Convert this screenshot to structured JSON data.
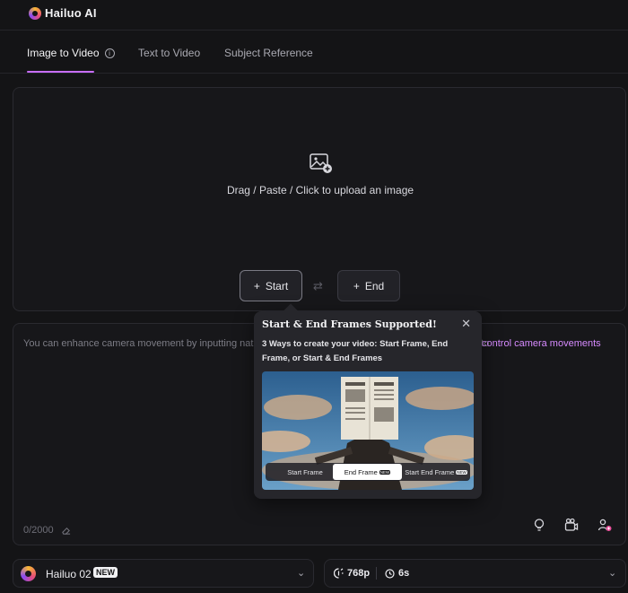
{
  "app": {
    "logo_text": "Hailuo AI"
  },
  "tabs": [
    {
      "label": "Image to Video",
      "active": true
    },
    {
      "label": "Text to Video",
      "active": false
    },
    {
      "label": "Subject Reference",
      "active": false
    }
  ],
  "upload": {
    "text": "Drag / Paste / Click to upload an image",
    "start_label": "Start",
    "end_label": "End"
  },
  "prompt": {
    "placeholder_visible": "You can enhance camera movement by inputting natu",
    "placeholder_tail": "how to",
    "link_text": "control camera movements",
    "counter": "0/2000"
  },
  "popover": {
    "title": "Start & End Frames Supported!",
    "body": "3 Ways to create your video: Start Frame, End Frame, or Start & End Frames",
    "segments": [
      {
        "label": "Start Frame",
        "badge": "",
        "active": false
      },
      {
        "label": "End Frame",
        "badge": "NEW",
        "active": true
      },
      {
        "label": "Start End Frame",
        "badge": "NEW",
        "active": false
      }
    ]
  },
  "model": {
    "name": "Hailuo 02",
    "badge": "NEW"
  },
  "settings": {
    "resolution": "768p",
    "duration": "6s"
  },
  "colors": {
    "accent": "#c86dff",
    "link": "#d78bff",
    "background": "#141416"
  }
}
